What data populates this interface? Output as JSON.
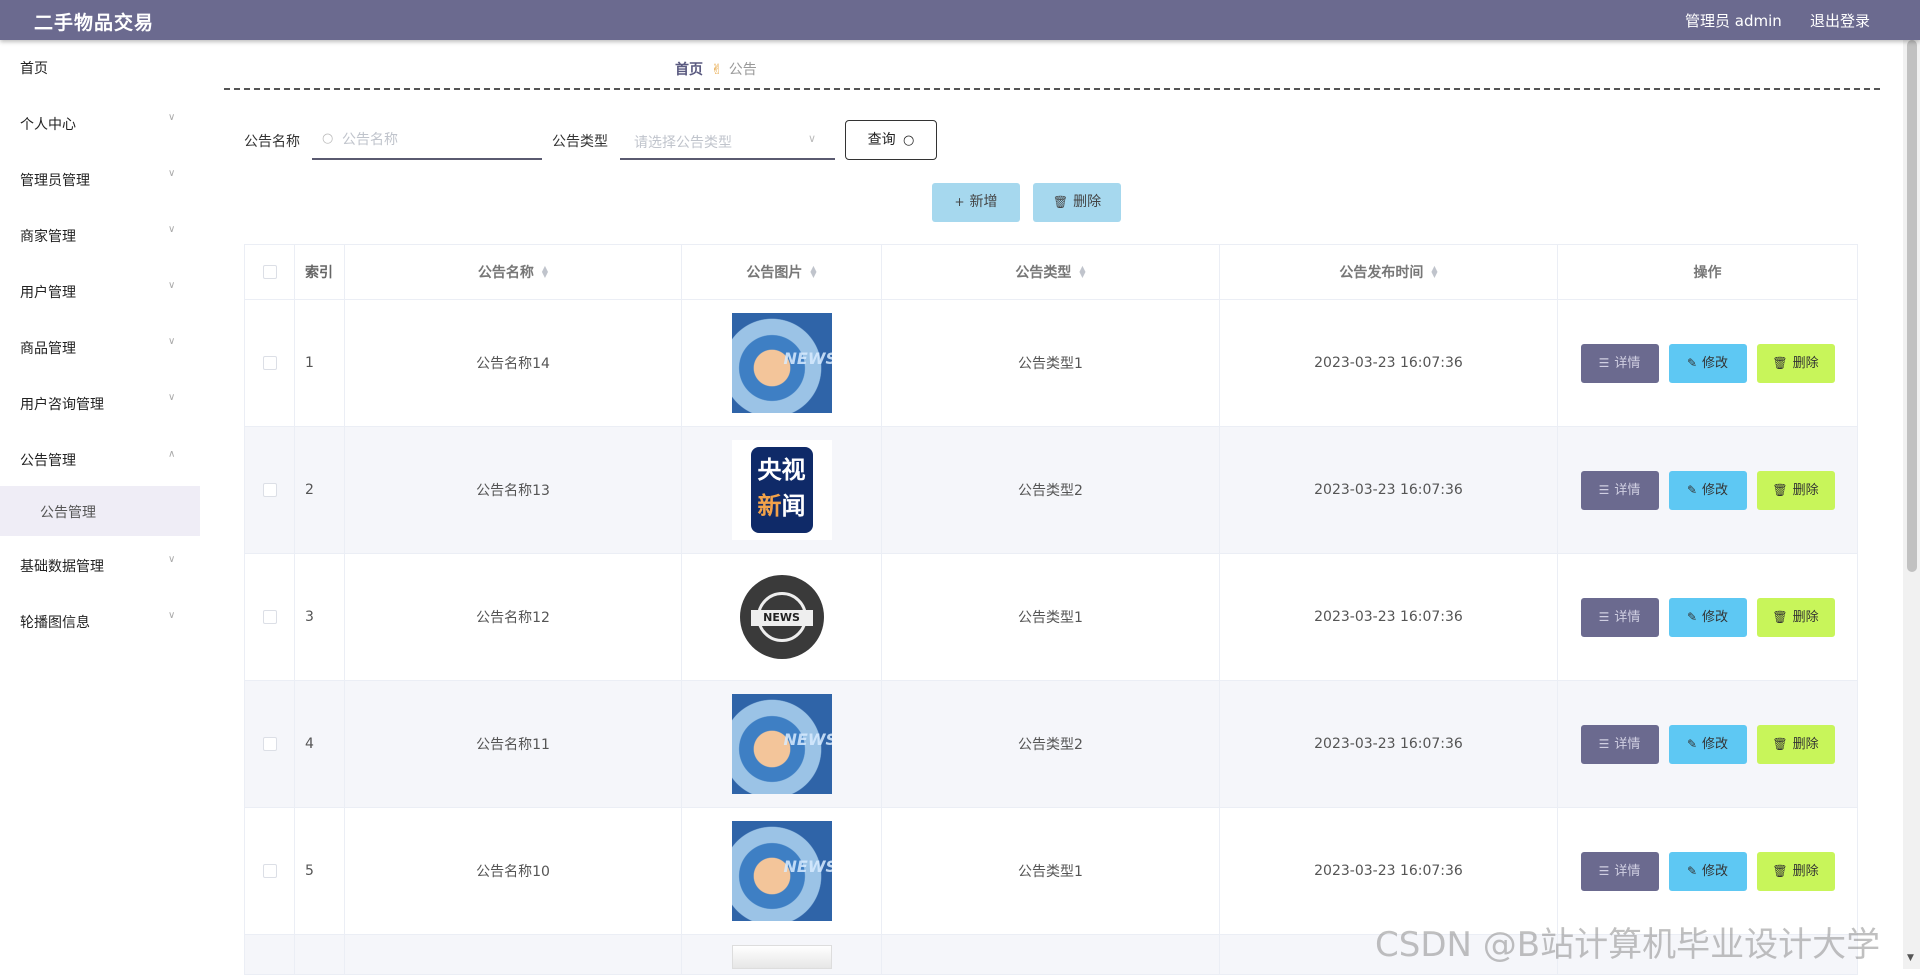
{
  "header": {
    "title": "二手物品交易",
    "user": "管理员 admin",
    "logout": "退出登录"
  },
  "sidebar": {
    "items": [
      {
        "label": "首页"
      },
      {
        "label": "个人中心"
      },
      {
        "label": "管理员管理"
      },
      {
        "label": "商家管理"
      },
      {
        "label": "用户管理"
      },
      {
        "label": "商品管理"
      },
      {
        "label": "用户咨询管理"
      },
      {
        "label": "公告管理"
      },
      {
        "label": "基础数据管理"
      },
      {
        "label": "轮播图信息"
      }
    ],
    "submenu": {
      "label": "公告管理"
    }
  },
  "breadcrumb": {
    "home": "首页",
    "current": "公告"
  },
  "search": {
    "name_label": "公告名称",
    "name_placeholder": "公告名称",
    "type_label": "公告类型",
    "type_placeholder": "请选择公告类型",
    "query_label": "查询"
  },
  "actions": {
    "add": "新增",
    "delete": "删除"
  },
  "table": {
    "columns": [
      "索引",
      "公告名称",
      "公告图片",
      "公告类型",
      "公告发布时间",
      "操作"
    ],
    "ops": {
      "detail": "详情",
      "edit": "修改",
      "delete": "删除"
    },
    "rows": [
      {
        "index": "1",
        "name": "公告名称14",
        "image": "news-blue",
        "type": "公告类型1",
        "time": "2023-03-23 16:07:36"
      },
      {
        "index": "2",
        "name": "公告名称13",
        "image": "cctv-news",
        "type": "公告类型2",
        "time": "2023-03-23 16:07:36"
      },
      {
        "index": "3",
        "name": "公告名称12",
        "image": "news-globe",
        "type": "公告类型1",
        "time": "2023-03-23 16:07:36"
      },
      {
        "index": "4",
        "name": "公告名称11",
        "image": "news-blue",
        "type": "公告类型2",
        "time": "2023-03-23 16:07:36"
      },
      {
        "index": "5",
        "name": "公告名称10",
        "image": "news-blue",
        "type": "公告类型1",
        "time": "2023-03-23 16:07:36"
      }
    ],
    "image_texts": {
      "news": "NEWS",
      "cctv_top": "央视",
      "cctv_bottom_1": "新",
      "cctv_bottom_2": "闻"
    }
  },
  "watermark": "CSDN @B站计算机毕业设计大学",
  "colors": {
    "header_bg": "#6b6a8f",
    "detail_btn": "#6b6a8f",
    "edit_btn": "#5ec8f3",
    "delete_btn": "#c8f55a",
    "add_btn": "#a6d8ee"
  }
}
